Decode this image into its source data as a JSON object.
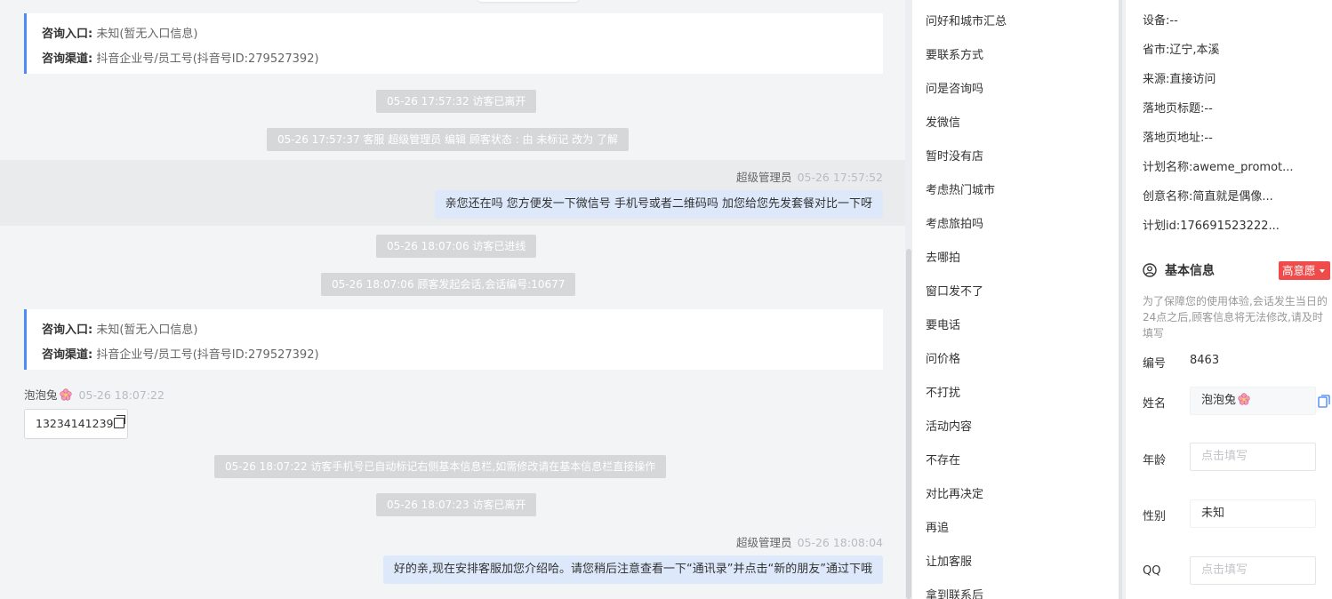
{
  "chat": {
    "entry_label": "咨询入口:",
    "entry_value": "未知(暂无入口信息)",
    "channel_label": "咨询渠道:",
    "channel_value": "抖音企业号/员工号(抖音号ID:279527392)",
    "sys1": "05-26 17:57:32 访客已离开",
    "sys2": "05-26 17:57:37 客服 超级管理员 编辑 顾客状态 : 由 未标记 改为 了解",
    "agent_name": "超级管理员",
    "agent_time1": "05-26 17:57:52",
    "agent_msg1": "亲您还在吗 您方便发一下微信号 手机号或者二维码吗 加您给您先发套餐对比一下呀",
    "sys3": "05-26 18:07:06 访客已进线",
    "sys4": "05-26 18:07:06 顾客发起会话,会话编号:10677",
    "visitor_name": "泡泡兔",
    "visitor_time": "05-26 18:07:22",
    "visitor_phone": "13234141239",
    "sys5": "05-26 18:07:22 访客手机号已自动标记右侧基本信息栏,如需修改请在基本信息栏直接操作",
    "sys6": "05-26 18:07:23 访客已离开",
    "agent_time2": "05-26 18:08:04",
    "agent_msg2": "好的亲,现在安排客服加您介绍哈。请您稍后注意查看一下“通讯录”并点击“新的朋友”通过下哦"
  },
  "quick_replies": [
    "问好和城市汇总",
    "要联系方式",
    "问是咨询吗",
    "发微信",
    "暂时没有店",
    "考虑热门城市",
    "考虑旅拍吗",
    "去哪拍",
    "窗口发不了",
    "要电话",
    "问价格",
    "不打扰",
    "活动内容",
    "不存在",
    "对比再决定",
    "再追",
    "让加客服",
    "拿到联系后"
  ],
  "info": {
    "device": "设备:--",
    "region": "省市:辽宁,本溪",
    "source": "来源:直接访问",
    "landing_title": "落地页标题:--",
    "landing_url": "落地页地址:--",
    "plan_name": "计划名称:aweme_promot...",
    "creative_name": "创意名称:简直就是偶像...",
    "plan_id": "计划id:176691523222..."
  },
  "basic": {
    "title": "基本信息",
    "intent_badge": "高意愿",
    "hint": "为了保障您的使用体验,会话发生当日的24点之后,顾客信息将无法修改,请及时填写",
    "id_label": "编号",
    "id_value": "8463",
    "name_label": "姓名",
    "name_value": "泡泡兔",
    "age_label": "年龄",
    "age_placeholder": "点击填写",
    "gender_label": "性别",
    "gender_value": "未知",
    "qq_label": "QQ",
    "qq_placeholder": "点击填写"
  },
  "colors": {
    "accent_blue": "#4a8ef5",
    "badge_red": "#ef4b4b",
    "bubble_blue": "#dde9fb"
  }
}
